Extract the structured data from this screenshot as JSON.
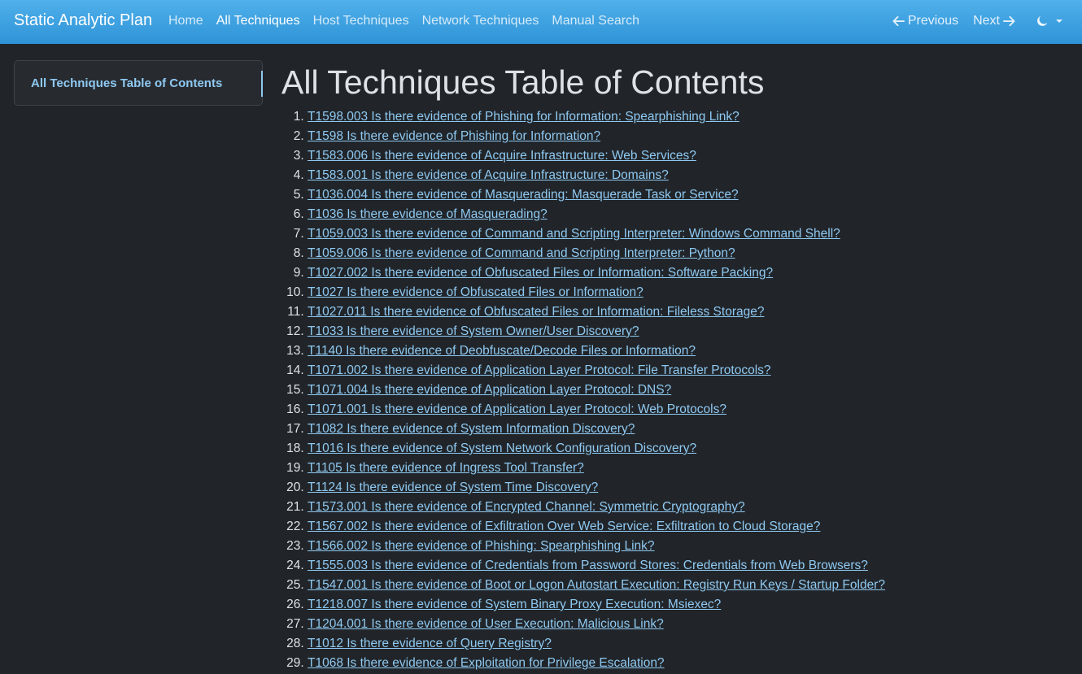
{
  "navbar": {
    "brand": "Static Analytic Plan",
    "links": [
      {
        "label": "Home"
      },
      {
        "label": "All Techniques"
      },
      {
        "label": "Host Techniques"
      },
      {
        "label": "Network Techniques"
      },
      {
        "label": "Manual Search"
      }
    ],
    "previous_label": "Previous",
    "next_label": "Next",
    "icons": {
      "previous": "arrow-left-icon",
      "next": "arrow-right-icon",
      "theme": "moon-icon",
      "theme_dropdown": "caret-down-icon"
    },
    "colors": {
      "bar": "#3fa3e2",
      "link_active": "#ffffff"
    }
  },
  "sidebar": {
    "items": [
      {
        "label": "All Techniques Table of Contents"
      }
    ]
  },
  "main": {
    "title": "All Techniques Table of Contents",
    "toc": [
      "T1598.003 Is there evidence of Phishing for Information: Spearphishing Link?",
      "T1598 Is there evidence of Phishing for Information?",
      "T1583.006 Is there evidence of Acquire Infrastructure: Web Services?",
      "T1583.001 Is there evidence of Acquire Infrastructure: Domains?",
      "T1036.004 Is there evidence of Masquerading: Masquerade Task or Service?",
      "T1036 Is there evidence of Masquerading?",
      "T1059.003 Is there evidence of Command and Scripting Interpreter: Windows Command Shell?",
      "T1059.006 Is there evidence of Command and Scripting Interpreter: Python?",
      "T1027.002 Is there evidence of Obfuscated Files or Information: Software Packing?",
      "T1027 Is there evidence of Obfuscated Files or Information?",
      "T1027.011 Is there evidence of Obfuscated Files or Information: Fileless Storage?",
      "T1033 Is there evidence of System Owner/User Discovery?",
      "T1140 Is there evidence of Deobfuscate/Decode Files or Information?",
      "T1071.002 Is there evidence of Application Layer Protocol: File Transfer Protocols?",
      "T1071.004 Is there evidence of Application Layer Protocol: DNS?",
      "T1071.001 Is there evidence of Application Layer Protocol: Web Protocols?",
      "T1082 Is there evidence of System Information Discovery?",
      "T1016 Is there evidence of System Network Configuration Discovery?",
      "T1105 Is there evidence of Ingress Tool Transfer?",
      "T1124 Is there evidence of System Time Discovery?",
      "T1573.001 Is there evidence of Encrypted Channel: Symmetric Cryptography?",
      "T1567.002 Is there evidence of Exfiltration Over Web Service: Exfiltration to Cloud Storage?",
      "T1566.002 Is there evidence of Phishing: Spearphishing Link?",
      "T1555.003 Is there evidence of Credentials from Password Stores: Credentials from Web Browsers?",
      "T1547.001 Is there evidence of Boot or Logon Autostart Execution: Registry Run Keys / Startup Folder?",
      "T1218.007 Is there evidence of System Binary Proxy Execution: Msiexec?",
      "T1204.001 Is there evidence of User Execution: Malicious Link?",
      "T1012 Is there evidence of Query Registry?",
      "T1068 Is there evidence of Exploitation for Privilege Escalation?"
    ],
    "colors": {
      "link": "#8fc9f2",
      "background": "#212529"
    }
  }
}
